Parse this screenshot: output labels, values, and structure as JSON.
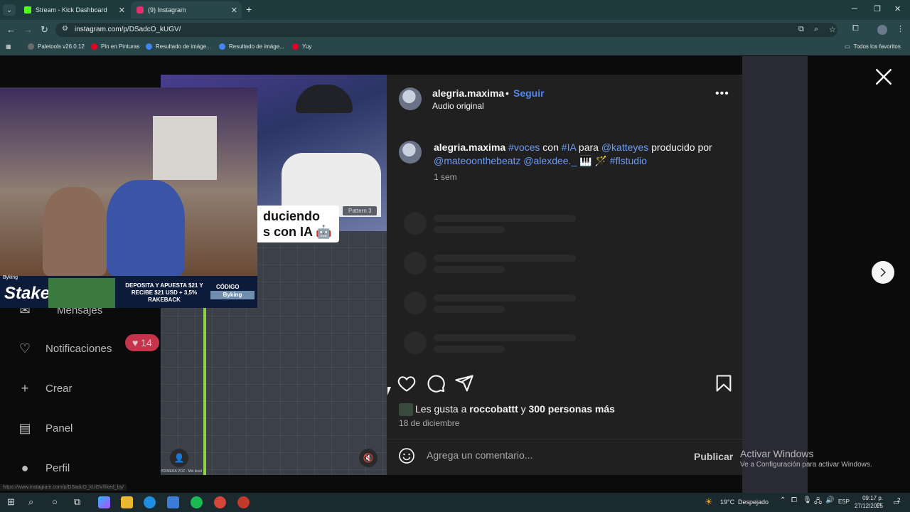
{
  "browser": {
    "tabs": [
      {
        "label": "Stream - Kick Dashboard",
        "favicon_color": "#53fc18"
      },
      {
        "label": "(9) Instagram",
        "favicon_color": "#e1306c"
      }
    ],
    "url": "instagram.com/p/DSadcO_kUGV/",
    "bookmarks": [
      {
        "label": "Paletools v26.0.12",
        "icon_color": "#6b6b6b"
      },
      {
        "label": "Pin en Pinturas",
        "icon_color": "#e60023"
      },
      {
        "label": "Resultado de imáge...",
        "icon_color": "#4285f4"
      },
      {
        "label": "Resultado de imáge...",
        "icon_color": "#4285f4"
      },
      {
        "label": "Yuy",
        "icon_color": "#e60023"
      }
    ],
    "all_bookmarks": "Todos los favoritos"
  },
  "sidebar": {
    "items": [
      {
        "label": "Mensajes",
        "icon": "message-icon"
      },
      {
        "label": "Notificaciones",
        "icon": "heart-icon"
      },
      {
        "label": "Crear",
        "icon": "plus-icon"
      },
      {
        "label": "Panel",
        "icon": "chart-icon"
      },
      {
        "label": "Perfil",
        "icon": "avatar-icon"
      }
    ],
    "notification_badge": "14"
  },
  "video": {
    "caption_line1": "duciendo",
    "caption_line2": "s con IA 🤖",
    "pattern_label": "Pattern 3",
    "mix_label": "PRIMERA VOZ - Mix level"
  },
  "stream_overlay": {
    "top_label": "Byking",
    "brand": "Stake",
    "ad_text": "DEPOSITA Y APUESTA $21 Y RECIBE $21 USD + 3,5% RAKEBACK",
    "code_label": "CÓDIGO",
    "code_value": "Byking"
  },
  "post": {
    "username": "alegria.maxima",
    "dot": "•",
    "follow_label": "Seguir",
    "audio": "Audio original",
    "more": "•••",
    "caption_parts": {
      "user": "alegria.maxima",
      "tag1": "#voces",
      "t1": " con ",
      "tag2": "#IA",
      "t2": " para ",
      "tag3": "@katteyes",
      "t3": " producido por ",
      "tag4": "@mateoonthebeatz",
      "t4": " ",
      "tag5": "@alexdee._",
      "t5": " 🎹 🪄 ",
      "tag6": "#flstudio"
    },
    "caption_time": "1 sem",
    "likes_prefix": "Les gusta a ",
    "likes_user": "roccobattt",
    "likes_mid": " y ",
    "likes_count": "300 personas más",
    "date": "18 de diciembre",
    "comment_placeholder": "Agrega un comentario...",
    "publish_label": "Publicar"
  },
  "windows_activation": {
    "line1": "Activar Windows",
    "line2": "Ve a Configuración para activar Windows."
  },
  "status_url": "https://www.instagram.com/p/DSadcO_kUGV/liked_by/",
  "taskbar": {
    "temperature": "19°C",
    "weather": "Despejado",
    "language": "ESP",
    "time": "09:17 p. m.",
    "date": "27/12/2025",
    "notifications": "2"
  }
}
